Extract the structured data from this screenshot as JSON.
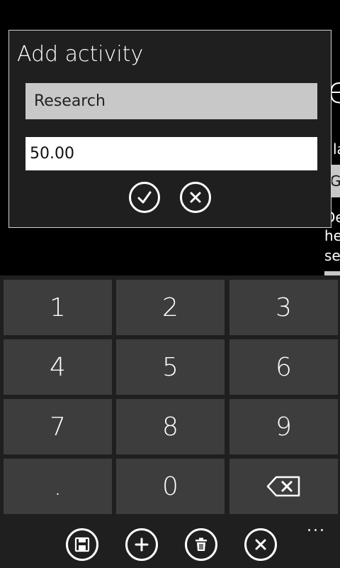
{
  "background": {
    "big_char": "e",
    "line1": "la",
    "box_text": "G",
    "line2": "De",
    "line3": "he",
    "line4": "se"
  },
  "dialog": {
    "title": "Add activity",
    "activity_value": "Research",
    "amount_value": "50.00",
    "confirm_icon": "check-icon",
    "cancel_icon": "close-icon"
  },
  "keypad": {
    "keys": [
      "1",
      "2",
      "3",
      "4",
      "5",
      "6",
      "7",
      "8",
      "9",
      ".",
      "0"
    ],
    "backspace_icon": "backspace-icon"
  },
  "appbar": {
    "icons": [
      "save-icon",
      "add-icon",
      "delete-icon",
      "close-icon"
    ],
    "more": "..."
  }
}
